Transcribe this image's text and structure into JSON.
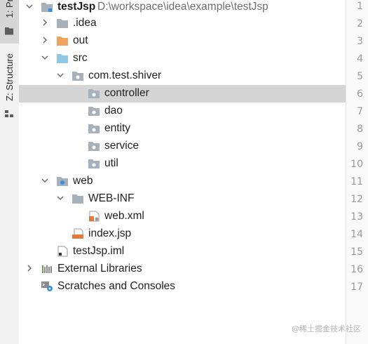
{
  "strip": {
    "project_tab": "1: Pr",
    "structure_tab": "Z: Structure"
  },
  "tree": {
    "root": {
      "label": "testJsp",
      "path": "D:\\workspace\\idea\\example\\testJsp"
    },
    "idea": ".idea",
    "out": "out",
    "src": "src",
    "package": "com.test.shiver",
    "controller": "controller",
    "dao": "dao",
    "entity": "entity",
    "service": "service",
    "util": "util",
    "web": "web",
    "webinf": "WEB-INF",
    "webxml": "web.xml",
    "indexjsp": "index.jsp",
    "iml": "testJsp.iml",
    "libraries": "External Libraries",
    "scratches": "Scratches and Consoles"
  },
  "gutter": {
    "lines": [
      "1",
      "2",
      "3",
      "4",
      "5",
      "6",
      "7",
      "8",
      "9",
      "10",
      "11",
      "12",
      "13",
      "14",
      "15",
      "16",
      "17"
    ]
  },
  "watermark": "@稀土掘金技术社区",
  "colors": {
    "folder": "#a7b1bc",
    "out_folder": "#f0a35c",
    "src_folder": "#8fc9e8",
    "selected_row": "#d5d5d5",
    "highlight_line": "#fcf8e3"
  }
}
